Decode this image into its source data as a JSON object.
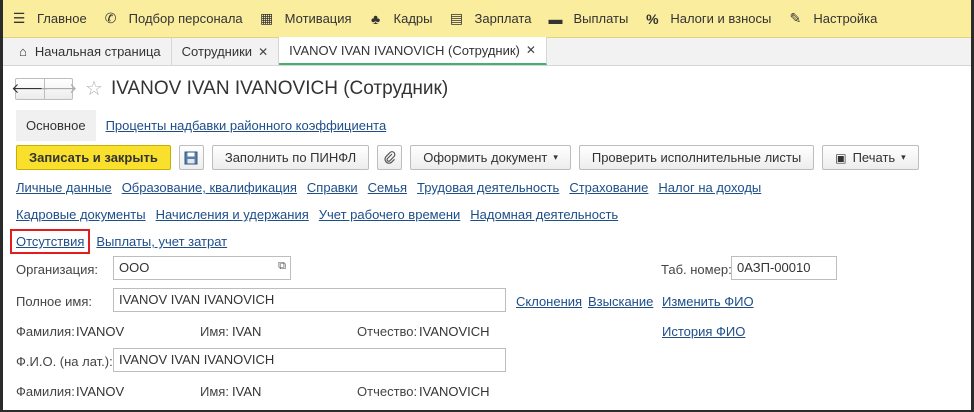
{
  "menu": [
    {
      "icon": "hamburger-icon",
      "glyph": "☰",
      "label": "Главное"
    },
    {
      "icon": "recruit-icon",
      "glyph": "✆",
      "label": "Подбор персонала"
    },
    {
      "icon": "gift-icon",
      "glyph": "▦",
      "label": "Мотивация"
    },
    {
      "icon": "people-icon",
      "glyph": "♣",
      "label": "Кадры"
    },
    {
      "icon": "calculator-icon",
      "glyph": "▤",
      "label": "Зарплата"
    },
    {
      "icon": "wallet-icon",
      "glyph": "▬",
      "label": "Выплаты"
    },
    {
      "icon": "percent-icon",
      "glyph": "%",
      "label": "Налоги и взносы"
    },
    {
      "icon": "wrench-icon",
      "glyph": "✎",
      "label": "Настройка"
    }
  ],
  "tabs": [
    {
      "label": "Начальная страница",
      "closable": false,
      "home": true
    },
    {
      "label": "Сотрудники",
      "closable": true
    },
    {
      "label": "IVANOV IVAN IVANOVICH (Сотрудник)",
      "closable": true
    }
  ],
  "tab_close_glyph": "✕",
  "nav": {
    "back": "🡐",
    "forward": "🡒",
    "favorite": "☆"
  },
  "title": "IVANOV IVAN IVANOVICH (Сотрудник)",
  "section_tabs": {
    "active": "Основное",
    "link": "Проценты надбавки районного коэффициента"
  },
  "toolbar": {
    "save_close": "Записать и закрыть",
    "fill_pinfl": "Заполнить по ПИНФЛ",
    "make_document": "Оформить документ",
    "check_sheets": "Проверить исполнительные листы",
    "print": "Печать",
    "caret": "▾"
  },
  "links_row1": [
    "Личные данные",
    "Образование, квалификация",
    "Справки",
    "Семья",
    "Трудовая деятельность",
    "Страхование",
    "Налог на доходы"
  ],
  "links_row2": [
    "Кадровые документы",
    "Начисления и удержания",
    "Учет рабочего времени",
    "Надомная деятельность"
  ],
  "links_row3": [
    "Отсутствия",
    "Выплаты, учет затрат"
  ],
  "form": {
    "org_label": "Организация:",
    "org_value": "ООО",
    "tab_number_label": "Таб. номер:",
    "tab_number_value": "0АЗП-00010",
    "full_name_label": "Полное имя:",
    "full_name_value": "IVANOV IVAN IVANOVICH",
    "declensions_link": "Склонения",
    "recovery_link": "Взыскание",
    "change_name_link": "Изменить ФИО",
    "surname_label": "Фамилия:",
    "surname_value": "IVANOV",
    "name_label": "Имя:",
    "name_value": "IVAN",
    "patronymic_label": "Отчество:",
    "patronymic_value": "IVANOVICH",
    "history_link": "История ФИО",
    "latin_label": "Ф.И.О. (на лат.):",
    "latin_value": "IVANOV IVAN IVANOVICH",
    "surname2_label": "Фамилия:",
    "surname2_value": "IVANOV",
    "name2_label": "Имя:",
    "name2_value": "IVAN",
    "patronymic2_label": "Отчество:",
    "patronymic2_value": "IVANOVICH"
  }
}
